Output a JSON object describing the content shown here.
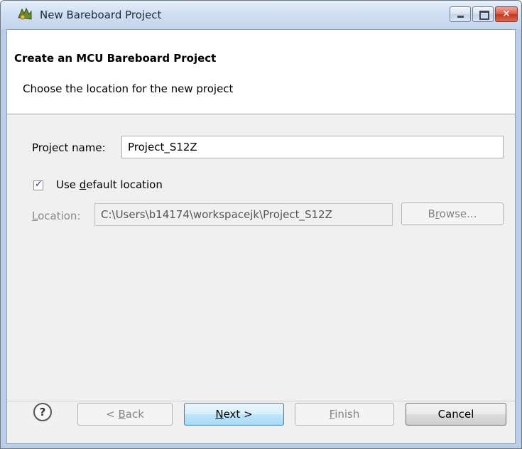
{
  "window": {
    "title": "New Bareboard Project"
  },
  "header": {
    "title": "Create an MCU Bareboard Project",
    "description": "Choose the location for the new project"
  },
  "form": {
    "project_name_label": "Project name:",
    "project_name_value": "Project_S12Z",
    "use_default_pre": "Use ",
    "use_default_accel": "d",
    "use_default_post": "efault location",
    "use_default_checked": true,
    "location_label_accel": "L",
    "location_label_rest": "ocation:",
    "location_value": "C:\\Users\\b14174\\workspacejk\\Project_S12Z",
    "browse_pre": "B",
    "browse_accel": "r",
    "browse_post": "owse..."
  },
  "buttons": {
    "back_pre": "< ",
    "back_accel": "B",
    "back_post": "ack",
    "next_accel": "N",
    "next_post": "ext >",
    "finish_accel": "F",
    "finish_post": "inish",
    "cancel": "Cancel",
    "help": "?"
  },
  "colors": {
    "accent": "#3c7fb1",
    "close": "#c4341e"
  },
  "icons": [
    "app-icon",
    "minimize-icon",
    "maximize-icon",
    "close-icon",
    "help-icon",
    "checkmark-icon"
  ]
}
